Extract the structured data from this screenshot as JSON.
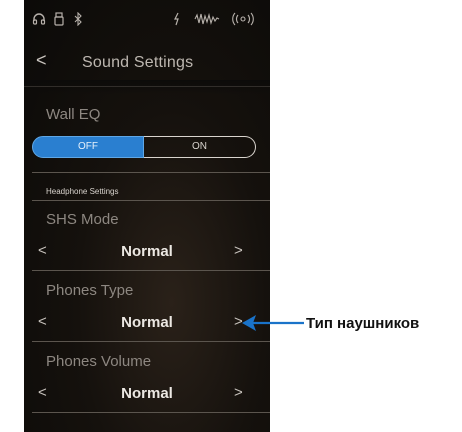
{
  "status_bar": {
    "icons": [
      "headphones-icon",
      "usb-icon",
      "bluetooth-icon",
      "microphone-icon",
      "audio-wave-icon",
      "wireless-icon"
    ]
  },
  "header": {
    "back_symbol": "<",
    "title": "Sound Settings"
  },
  "wall_eq": {
    "label": "Wall EQ",
    "options": [
      "OFF",
      "ON"
    ],
    "selected": "OFF",
    "accent_color": "#2a7fd0"
  },
  "headphone_section": {
    "title": "Headphone Settings",
    "settings": [
      {
        "label": "SHS Mode",
        "prev": "<",
        "value": "Normal",
        "next": ">"
      },
      {
        "label": "Phones Type",
        "prev": "<",
        "value": "Normal",
        "next": ">"
      },
      {
        "label": "Phones Volume",
        "prev": "<",
        "value": "Normal",
        "next": ">"
      }
    ]
  },
  "callout": {
    "text": "Тип наушников",
    "color": "#1a73c9"
  }
}
